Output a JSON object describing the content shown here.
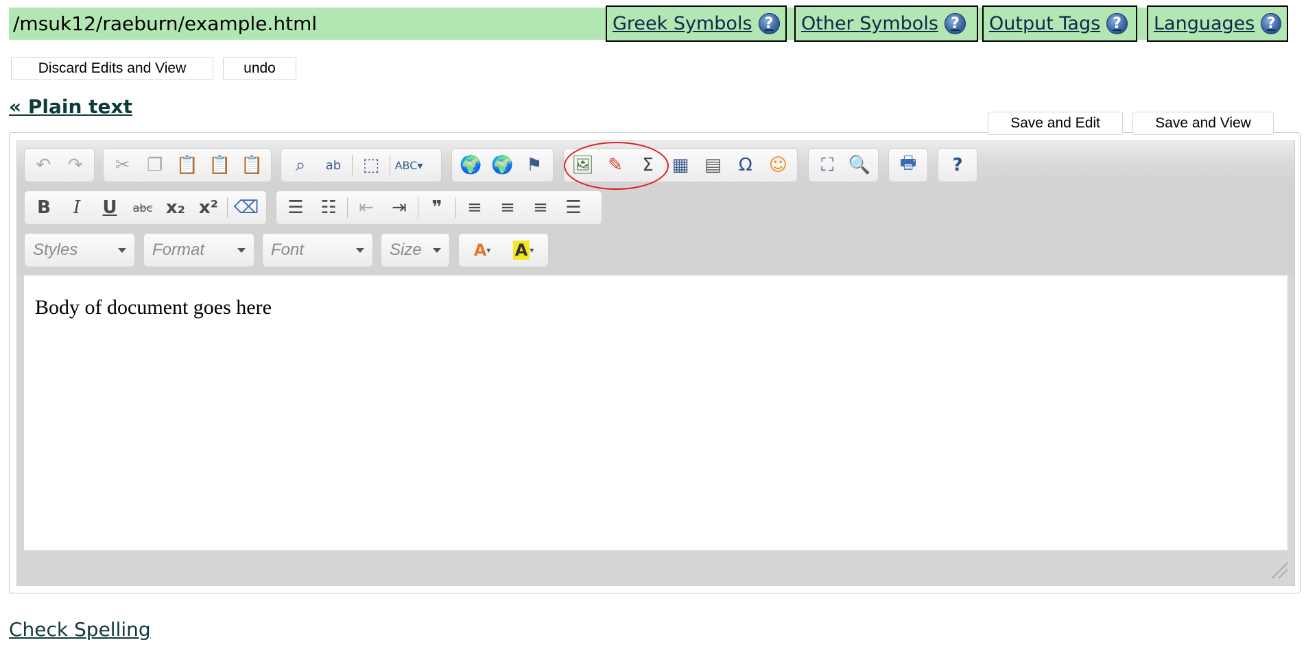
{
  "header": {
    "path": "/msuk12/raeburn/example.html",
    "help_links": [
      {
        "label": "Greek Symbols",
        "icon": "help-icon",
        "help": "?"
      },
      {
        "label": "Other Symbols",
        "icon": "help-icon",
        "help": "?"
      },
      {
        "label": "Output Tags",
        "icon": "help-icon",
        "help": "?"
      },
      {
        "label": "Languages",
        "icon": "help-icon",
        "help": "?"
      }
    ],
    "bar_color": "#b2e6b2"
  },
  "actions": {
    "discard_label": "Discard Edits and View",
    "undo_label": "undo",
    "plain_text_link": "« Plain text",
    "save_edit_label": "Save and Edit",
    "save_view_label": "Save and View"
  },
  "toolbar": {
    "row1": [
      [
        "undo-icon",
        "redo-icon"
      ],
      [
        "cut-icon",
        "copy-icon",
        "paste-icon",
        "paste-text-icon",
        "paste-word-icon"
      ],
      [
        "find-icon",
        "replace-icon",
        "select-all-icon",
        "spellcheck-icon"
      ],
      [
        "link-icon",
        "unlink-icon",
        "anchor-icon"
      ],
      [
        "image-icon",
        "mathml-icon",
        "sigma-icon",
        "table-icon",
        "horizontal-rule-icon",
        "special-char-icon",
        "smiley-icon"
      ],
      [
        "maximize-icon",
        "preview-icon"
      ],
      [
        "print-icon"
      ],
      [
        "help-icon"
      ]
    ],
    "row2": [
      [
        "bold-icon",
        "italic-icon",
        "underline-icon",
        "strikethrough-icon",
        "subscript-icon",
        "superscript-icon",
        "remove-format-icon"
      ],
      [
        "numbered-list-icon",
        "bulleted-list-icon",
        "outdent-icon",
        "indent-icon",
        "blockquote-icon",
        "align-left-icon",
        "align-center-icon",
        "align-right-icon",
        "justify-icon"
      ]
    ],
    "combos": {
      "styles": "Styles",
      "format": "Format",
      "font": "Font",
      "size": "Size"
    },
    "highlight_color": "#e11d1d"
  },
  "document": {
    "body": "Body of document goes here"
  },
  "footer": {
    "check_spelling": "Check Spelling"
  }
}
